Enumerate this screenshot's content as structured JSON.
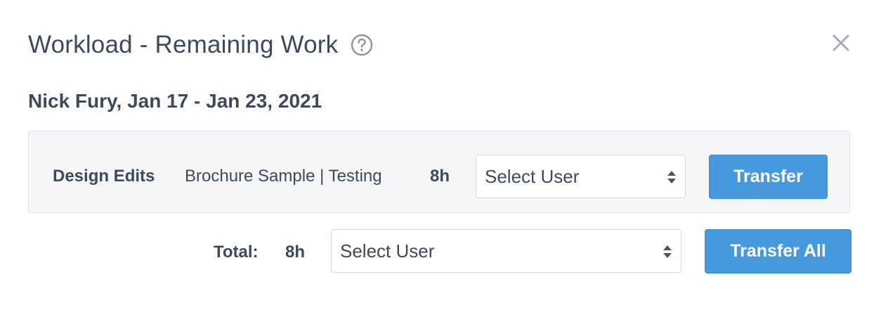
{
  "header": {
    "title": "Workload - Remaining Work",
    "help_icon": "question-circle-icon",
    "close_icon": "close-x-icon"
  },
  "subtitle": "Nick Fury, Jan 17 - Jan 23, 2021",
  "task": {
    "name": "Design Edits",
    "project": "Brochure Sample | Testing",
    "hours": "8h",
    "select_value": "Select User",
    "transfer_label": "Transfer"
  },
  "total": {
    "label": "Total:",
    "hours": "8h",
    "select_value": "Select User",
    "transfer_all_label": "Transfer All"
  },
  "colors": {
    "primary_button": "#4599dc",
    "text": "#3d4a5b",
    "row_background": "#f4f6f8",
    "icon_gray": "#8a94a3"
  }
}
